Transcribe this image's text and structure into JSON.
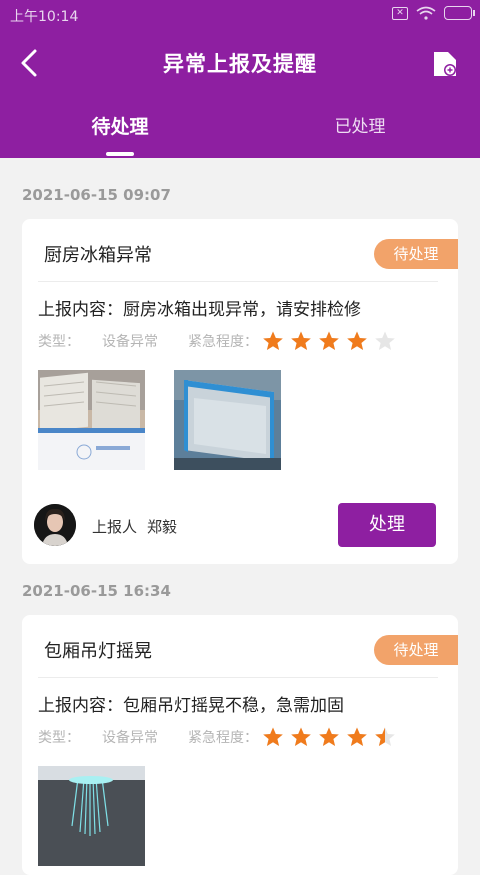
{
  "status_bar": {
    "time": "上午10:14"
  },
  "header": {
    "title": "异常上报及提醒"
  },
  "tabs": [
    {
      "label": "待处理",
      "active": true
    },
    {
      "label": "已处理",
      "active": false
    }
  ],
  "colors": {
    "primary": "#8e1fa1",
    "badge": "#f2a36a",
    "star": "#f07b1c",
    "star_empty": "#e6e6e6"
  },
  "labels": {
    "content_prefix": "上报内容：",
    "type_label": "类型：",
    "urgency_label": "紧急程度：",
    "reporter_label": "上报人",
    "handle_button": "处理"
  },
  "reports": [
    {
      "date": "2021-06-15 09:07",
      "title": "厨房冰箱异常",
      "status": "待处理",
      "content": "厨房冰箱出现异常，请安排检修",
      "type": "设备异常",
      "urgency": 4,
      "reporter": "郑毅"
    },
    {
      "date": "2021-06-15 16:34",
      "title": "包厢吊灯摇晃",
      "status": "待处理",
      "content": "包厢吊灯摇晃不稳，急需加固",
      "type": "设备异常",
      "urgency": 4.5
    }
  ]
}
